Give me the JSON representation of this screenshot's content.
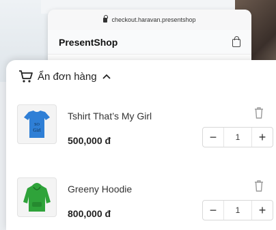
{
  "browser": {
    "url": "checkout.haravan.presentshop",
    "site_name": "PresentShop"
  },
  "cart": {
    "toggle_label": "Ẩn đơn hàng",
    "items": [
      {
        "name": "Tshirt That’s My Girl",
        "price": "500,000 đ",
        "quantity": "1",
        "decrement": "−",
        "increment": "+",
        "product_color": "#2f7fd6"
      },
      {
        "name": "Greeny Hoodie",
        "price": "800,000 đ",
        "quantity": "1",
        "decrement": "−",
        "increment": "+",
        "product_color": "#2fa33a"
      }
    ]
  },
  "icons": {
    "cart": "shopping-cart-icon",
    "chevron": "chevron-up-icon",
    "trash": "trash-icon",
    "bag": "shopping-bag-icon",
    "lock": "lock-icon"
  }
}
